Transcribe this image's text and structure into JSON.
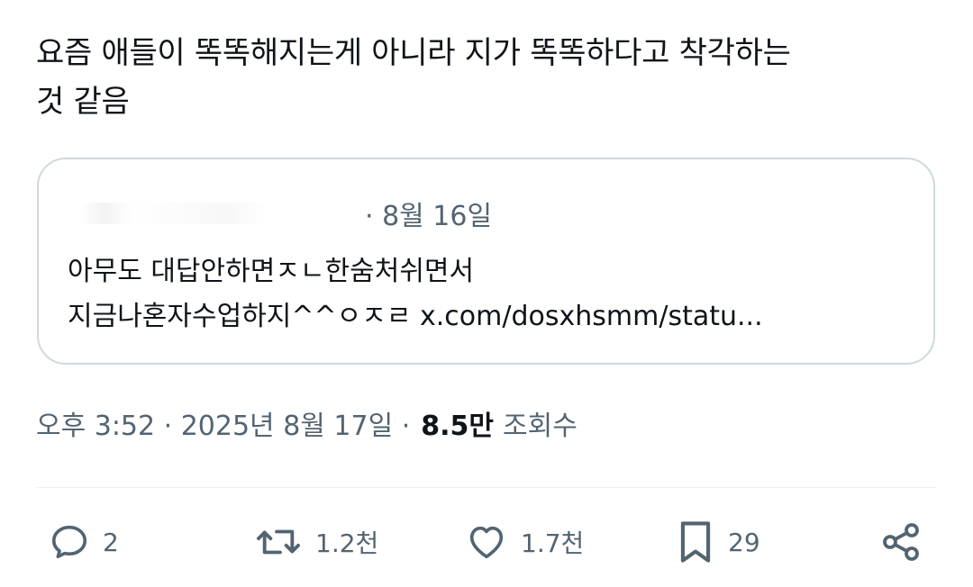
{
  "post": {
    "text_line1": "요즘 애들이 똑똑해지는게 아니라 지가 똑똑하다고 착각하는",
    "text_line2": "것 같음"
  },
  "quote": {
    "date": "· 8월 16일",
    "body_line1": "아무도 대답안하면ㅈㄴ한숨처쉬면서",
    "body_line2": "지금나혼자수업하지^^ㅇㅈㄹ x.com/dosxhsmm/statu..."
  },
  "meta": {
    "timestamp": "오후 3:52 · 2025년 8월 17일 ·",
    "views_count": "8.5만",
    "views_label": "조회수"
  },
  "actions": {
    "reply_count": "2",
    "repost_count": "1.2천",
    "like_count": "1.7천",
    "bookmark_count": "29"
  },
  "icons": {
    "reply": "reply-icon",
    "repost": "repost-icon",
    "like": "heart-icon",
    "bookmark": "bookmark-icon",
    "share": "share-icon"
  },
  "colors": {
    "text": "#0f1419",
    "secondary": "#536471",
    "border": "#cfd9de"
  }
}
